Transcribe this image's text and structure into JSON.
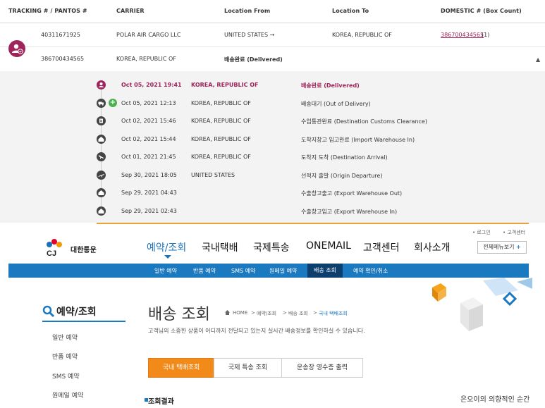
{
  "header": {
    "tracking": "TRACKING # / PANTOS #",
    "carrier": "CARRIER",
    "from": "Location From",
    "to": "Location To",
    "domestic": "DOMESTIC # (Box Count)"
  },
  "rows": [
    {
      "tracking": "40311671925",
      "carrier": "POLAR AIR CARGO LLC",
      "from": "UNITED STATES →",
      "to": "KOREA, REPUBLIC OF",
      "domestic": "386700434565",
      "count": "(1)"
    },
    {
      "tracking": "386700434565",
      "carrier": "KOREA, REPUBLIC OF",
      "status": "배송완료    (Delivered)"
    }
  ],
  "collapse_icon": "▲",
  "events": [
    {
      "date": "Oct 05, 2021 19:41",
      "location": "KOREA, REPUBLIC OF",
      "status": "배송완료 (Delivered)"
    },
    {
      "date": "Oct 05, 2021 12:13",
      "location": "KOREA, REPUBLIC OF",
      "status": "배송대기 (Out of Delivery)"
    },
    {
      "date": "Oct 02, 2021 15:46",
      "location": "KOREA, REPUBLIC OF",
      "status": "수입통관완료 (Destination Customs Clearance)"
    },
    {
      "date": "Oct 02, 2021 15:44",
      "location": "KOREA, REPUBLIC OF",
      "status": "도착지창고 입고완료 (Import Warehouse In)"
    },
    {
      "date": "Oct 01, 2021 21:45",
      "location": "KOREA, REPUBLIC OF",
      "status": "도착지 도착 (Destination Arrival)"
    },
    {
      "date": "Sep 30, 2021 18:05",
      "location": "UNITED STATES",
      "status": "선적지 출발 (Origin Departure)"
    },
    {
      "date": "Sep 29, 2021 04:43",
      "location": "",
      "status": "수출창고출고 (Export Warehouse Out)"
    },
    {
      "date": "Sep 29, 2021 02:43",
      "location": "",
      "status": "수출창고입고 (Export Warehouse In)"
    }
  ],
  "cj": {
    "util_login": "• 로그인",
    "util_center": "• 고객센터",
    "logo_mark": "CJ",
    "logo_text": "대한통운",
    "gnb": [
      "예약/조회",
      "국내택배",
      "국제특송",
      "ONEMAIL",
      "고객센터",
      "회사소개"
    ],
    "all_menu": "전체메뉴보기",
    "all_menu_icon": "+",
    "subnav": [
      "일반 예약",
      "반품 예약",
      "SMS 예약",
      "원메일 예약",
      "배송 조회",
      "예약 확인/취소"
    ],
    "lnb_title": "예약/조회",
    "lnb_items": [
      "일반 예약",
      "반품 예약",
      "SMS 예약",
      "원메일 예약"
    ],
    "page_title": "배송 조회",
    "breadcrumb_home": "HOME",
    "breadcrumb": [
      ">",
      "예약/조회",
      ">",
      "배송 조회",
      ">",
      "국내 택배조회"
    ],
    "description": "고객님의 소중한 상품이 어디까지 전달되고 있는지 실시간 배송정보를 확인하실 수 있습니다.",
    "tabs": [
      "국내 택배조회",
      "국제 특송 조회",
      "운송장 영수증 출력"
    ],
    "result_title": "조회결과",
    "ticker": "은오이의 의향적인 순간",
    "accent": "#1b79c0",
    "brand_orange": "#f28a1a"
  }
}
